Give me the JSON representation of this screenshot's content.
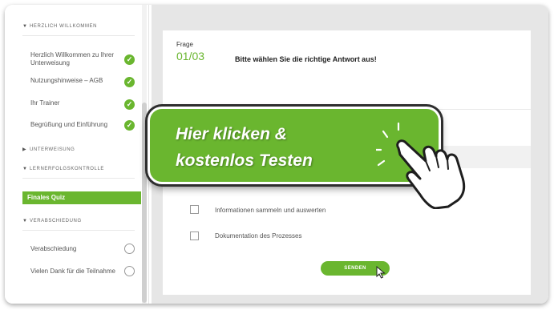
{
  "sidebar": {
    "sections": [
      {
        "label": "HERZLICH WILLKOMMEN",
        "state": "expanded"
      },
      {
        "label": "UNTERWEISUNG",
        "state": "collapsed"
      },
      {
        "label": "LERNERFOLGSKONTROLLE",
        "state": "expanded"
      },
      {
        "label": "VERABSCHIEDUNG",
        "state": "expanded"
      }
    ],
    "items": [
      {
        "label": "Herzlich Willkommen zu Ihrer Unterweisung",
        "status": "done"
      },
      {
        "label": "Nutzungshinweise – AGB",
        "status": "done"
      },
      {
        "label": "Ihr Trainer",
        "status": "done"
      },
      {
        "label": "Begrüßung und Einführung",
        "status": "done"
      },
      {
        "label": "Finales Quiz",
        "status": "active"
      },
      {
        "label": "Verabschiedung",
        "status": "open"
      },
      {
        "label": "Vielen Dank für die Teilnahme",
        "status": "open"
      }
    ]
  },
  "quiz": {
    "frage_label": "Frage",
    "frage_number": "01/03",
    "question": "Bitte wählen Sie die richtige Antwort aus!",
    "options": [
      {
        "label": "Informationen sammeln und auswerten",
        "checked": false
      },
      {
        "label": "Dokumentation des Prozesses",
        "checked": false
      }
    ],
    "submit_label": "SENDEN"
  },
  "cta": {
    "line1": "Hier klicken &",
    "line2": "kostenlos Testen"
  },
  "icons": {
    "check": "check-icon",
    "hand": "pointing-hand-icon",
    "cursor": "mouse-cursor-icon"
  },
  "colors": {
    "accent": "#6ab62f",
    "background": "#e6e6e6"
  }
}
